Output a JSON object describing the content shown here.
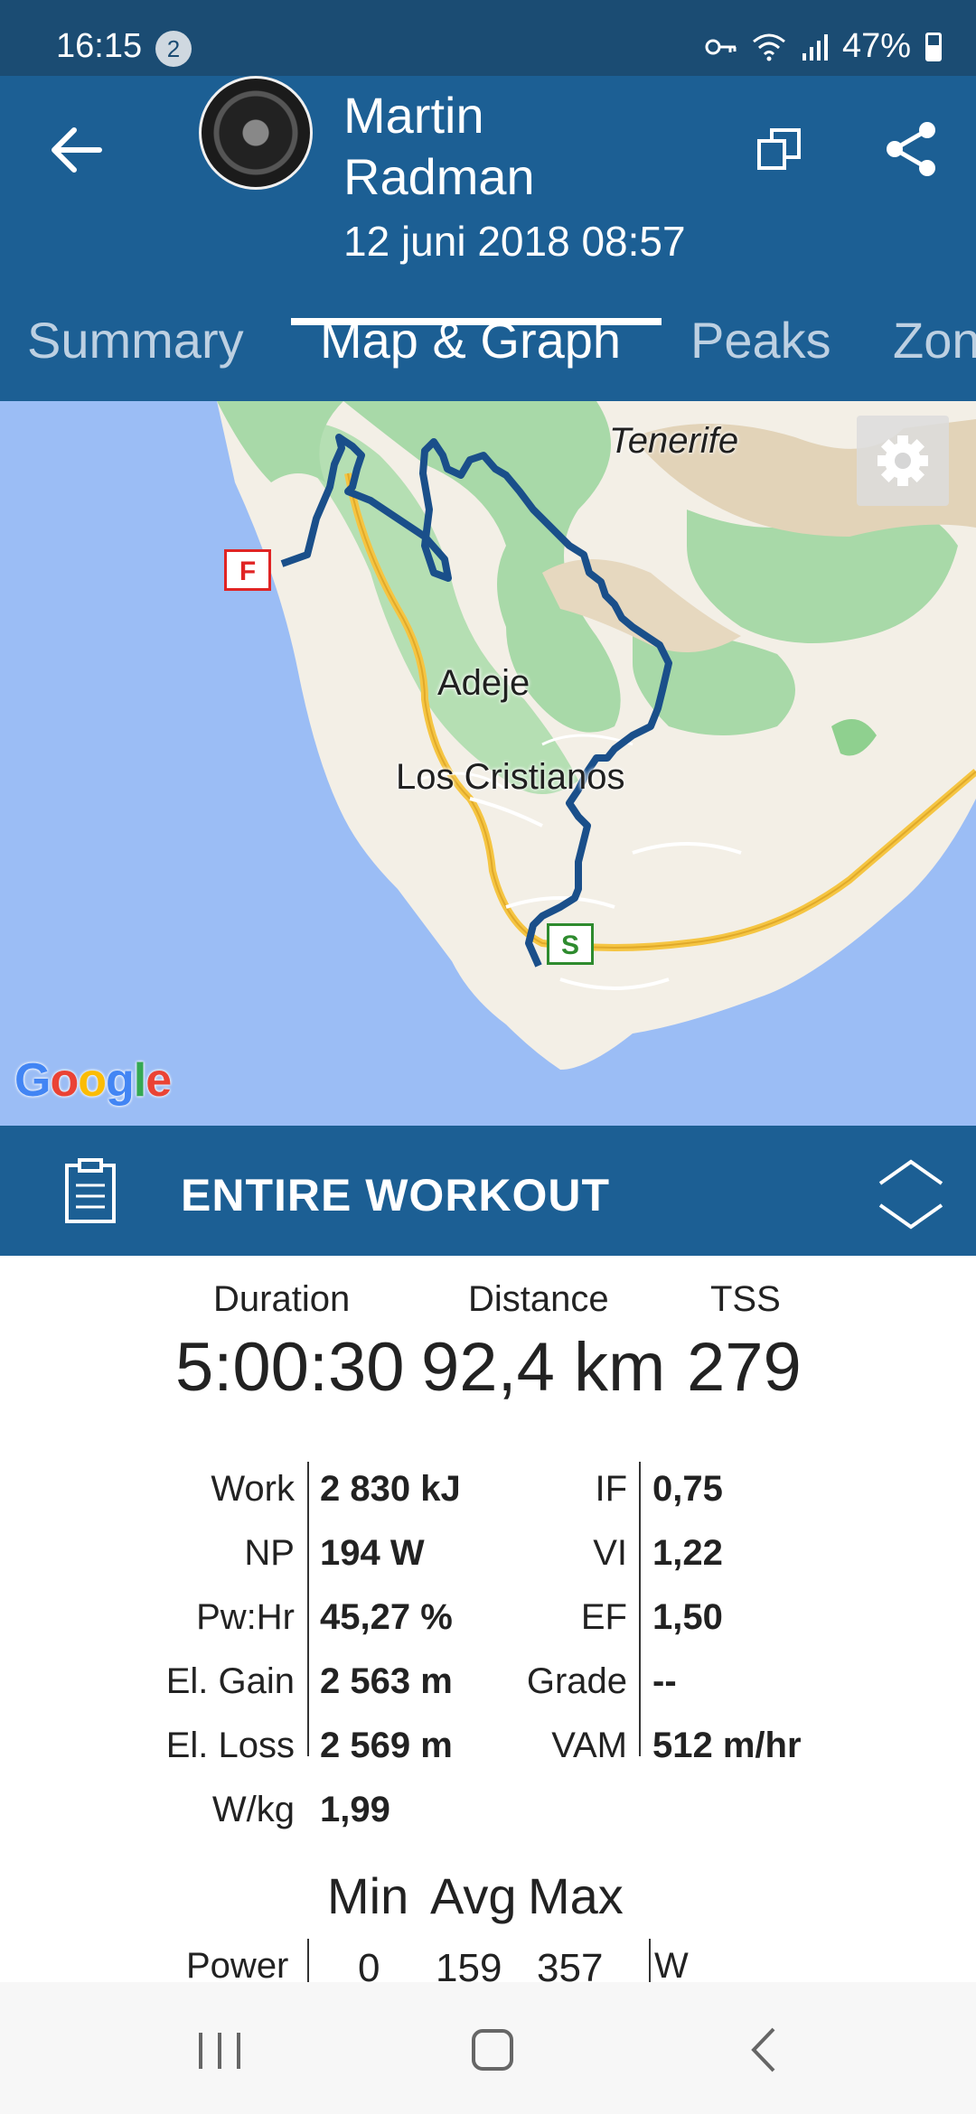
{
  "status_bar": {
    "time": "16:15",
    "notification_count": "2",
    "battery": "47%"
  },
  "header": {
    "user_name": "Martin Radman",
    "date": "12 juni 2018  08:57",
    "tabs": [
      "Summary",
      "Map & Graph",
      "Peaks",
      "Zon"
    ],
    "active_tab": "Map & Graph"
  },
  "map": {
    "labels": {
      "island": "Tenerife",
      "town1": "Adeje",
      "town2": "Los Cristianos"
    },
    "finish_marker": "F",
    "start_marker": "S",
    "attribution": "Google",
    "route_color": "#1a4f8a"
  },
  "section": {
    "title": "ENTIRE WORKOUT"
  },
  "summary": {
    "duration_label": "Duration",
    "duration": "5:00:30",
    "distance_label": "Distance",
    "distance": "92,4 km",
    "tss_label": "TSS",
    "tss": "279"
  },
  "metrics_left": [
    {
      "label": "Work",
      "value": "2 830 kJ"
    },
    {
      "label": "NP",
      "value": "194 W"
    },
    {
      "label": "Pw:Hr",
      "value": "45,27 %"
    },
    {
      "label": "El. Gain",
      "value": "2 563 m"
    },
    {
      "label": "El. Loss",
      "value": "2 569 m"
    },
    {
      "label": "W/kg",
      "value": "1,99"
    }
  ],
  "metrics_right": [
    {
      "label": "IF",
      "value": "0,75"
    },
    {
      "label": "VI",
      "value": "1,22"
    },
    {
      "label": "EF",
      "value": "1,50"
    },
    {
      "label": "Grade",
      "value": "--"
    },
    {
      "label": "VAM",
      "value": "512 m/hr"
    }
  ],
  "min_avg_max": {
    "headers": [
      "Min",
      "Avg",
      "Max"
    ],
    "rows": [
      {
        "label": "Power",
        "min": "0",
        "avg": "159",
        "max": "357",
        "unit": "W"
      }
    ]
  },
  "colors": {
    "header": "#1c5f94",
    "status_bar": "#1b4c73",
    "water": "#9bbdf5",
    "land": "#f3efe6",
    "forest": "#a8d9a8",
    "road": "#f5c542"
  }
}
